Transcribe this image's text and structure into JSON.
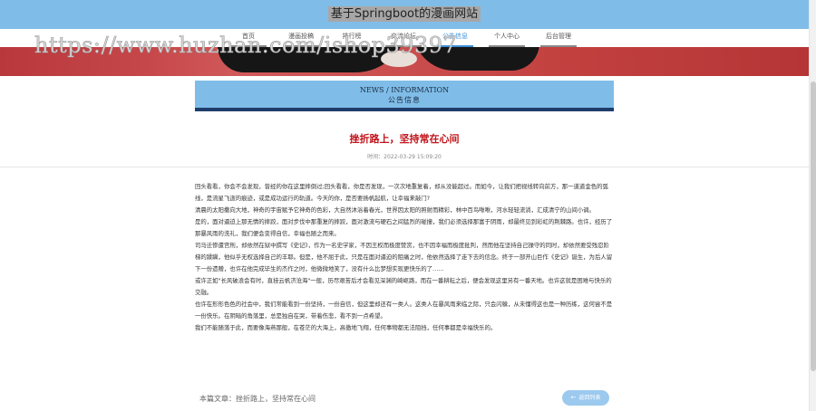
{
  "header": {
    "title": "基于Springboot的漫画网站"
  },
  "nav": [
    {
      "label": "首页",
      "active": false
    },
    {
      "label": "漫画投稿",
      "active": false
    },
    {
      "label": "排行榜",
      "active": false
    },
    {
      "label": "交流论坛",
      "active": false
    },
    {
      "label": "公告信息",
      "active": true
    },
    {
      "label": "个人中心",
      "active": false
    },
    {
      "label": "后台管理",
      "active": false
    }
  ],
  "watermark": "https://www.huzhan.com/ishop39397",
  "section": {
    "en": "NEWS / INFORMATION",
    "zh": "公告信息"
  },
  "article": {
    "title": "挫折路上，坚持常在心间",
    "time": "时间：2022-03-29 15:09:20",
    "paragraphs": [
      "回头看看，你会不会发现，曾经的你在这里摔倒过;回头看看，你是否发现，一次次地重复着，却从没能超过。而如今，让我们把视线转向前方，那一道道金色的弧线，是流星飞逝的痕迹，或是成功运行的轨道。今天的你，是否要扬帆起航，让幸福来敲门?",
      "清晨的太阳撒向大地，神奇的宇宙赋予它神奇的色彩，大自然沐浴着春光，世界因太阳的照射而精彩，林中百鸟啾啾，河水轻轻流淌，汇成清宁的山间小调。",
      "是的，面对逼迫上那无情的摔跤，面对步伐中那重复的摔跤，面对激流与硬石之间猛烈的碰撞，我们必须选择那富于阴雨，却最终见到彩虹的荆棘路。也许，经历了那暴风雨的洗礼，我们便会变得自信，幸福也随之而来。",
      "司马迁惨遭宫刑，却依然在狱中撰写《史记》，作为一名史学家，不因王权而极度赞赏，也不因幸福而极度批判，然而他在坚持自己操守的同时，却依然要受残忍阶梯的蹂躏，他似乎无权选择自己的丰耶。但是，他不屈于此，只是在面对逼迫的阻痛之时，他依然选择了走下去的信念。终于一部开山巨作《史记》诞生，为后人留下一份遗赠，也许在他完成毕生的杰作之时，他微微地笑了，没有什么比梦想实现更快乐的了……",
      "或许正如\"长风破浪会有时，直挂云帆济沧海\"一般，历尽艰苦后才会看见深渊的崎岖路，而在一番耕耘之后，便会发现这里另有一番天地。也许这就是困难与快乐的交融。",
      "也许在形形色色的社会中，我们常能看到一份坚持，一份自信，但这里却还有一类人。这类人在暴风雨来临之际，只会闪躲，从未懂得这也是一种历练，这何尝不是一份快乐。在阴暗的角落里，总是独自在哭，带着伤悲，看不到一点希望。",
      "我们不能随落于此，而要像海燕那般，在苍茫的大海上，高傲地飞翔，任何事物都无法阻挡，任何事都是幸福快乐的。"
    ]
  },
  "footer": {
    "label": "本篇文章：挫折路上，坚持常在心间",
    "back_label": "返回列表",
    "back_icon": "arrow-left-icon"
  },
  "colors": {
    "accent": "#7fbde8",
    "title_red": "#c0141b",
    "dark_bar": "#1f3d6b"
  }
}
